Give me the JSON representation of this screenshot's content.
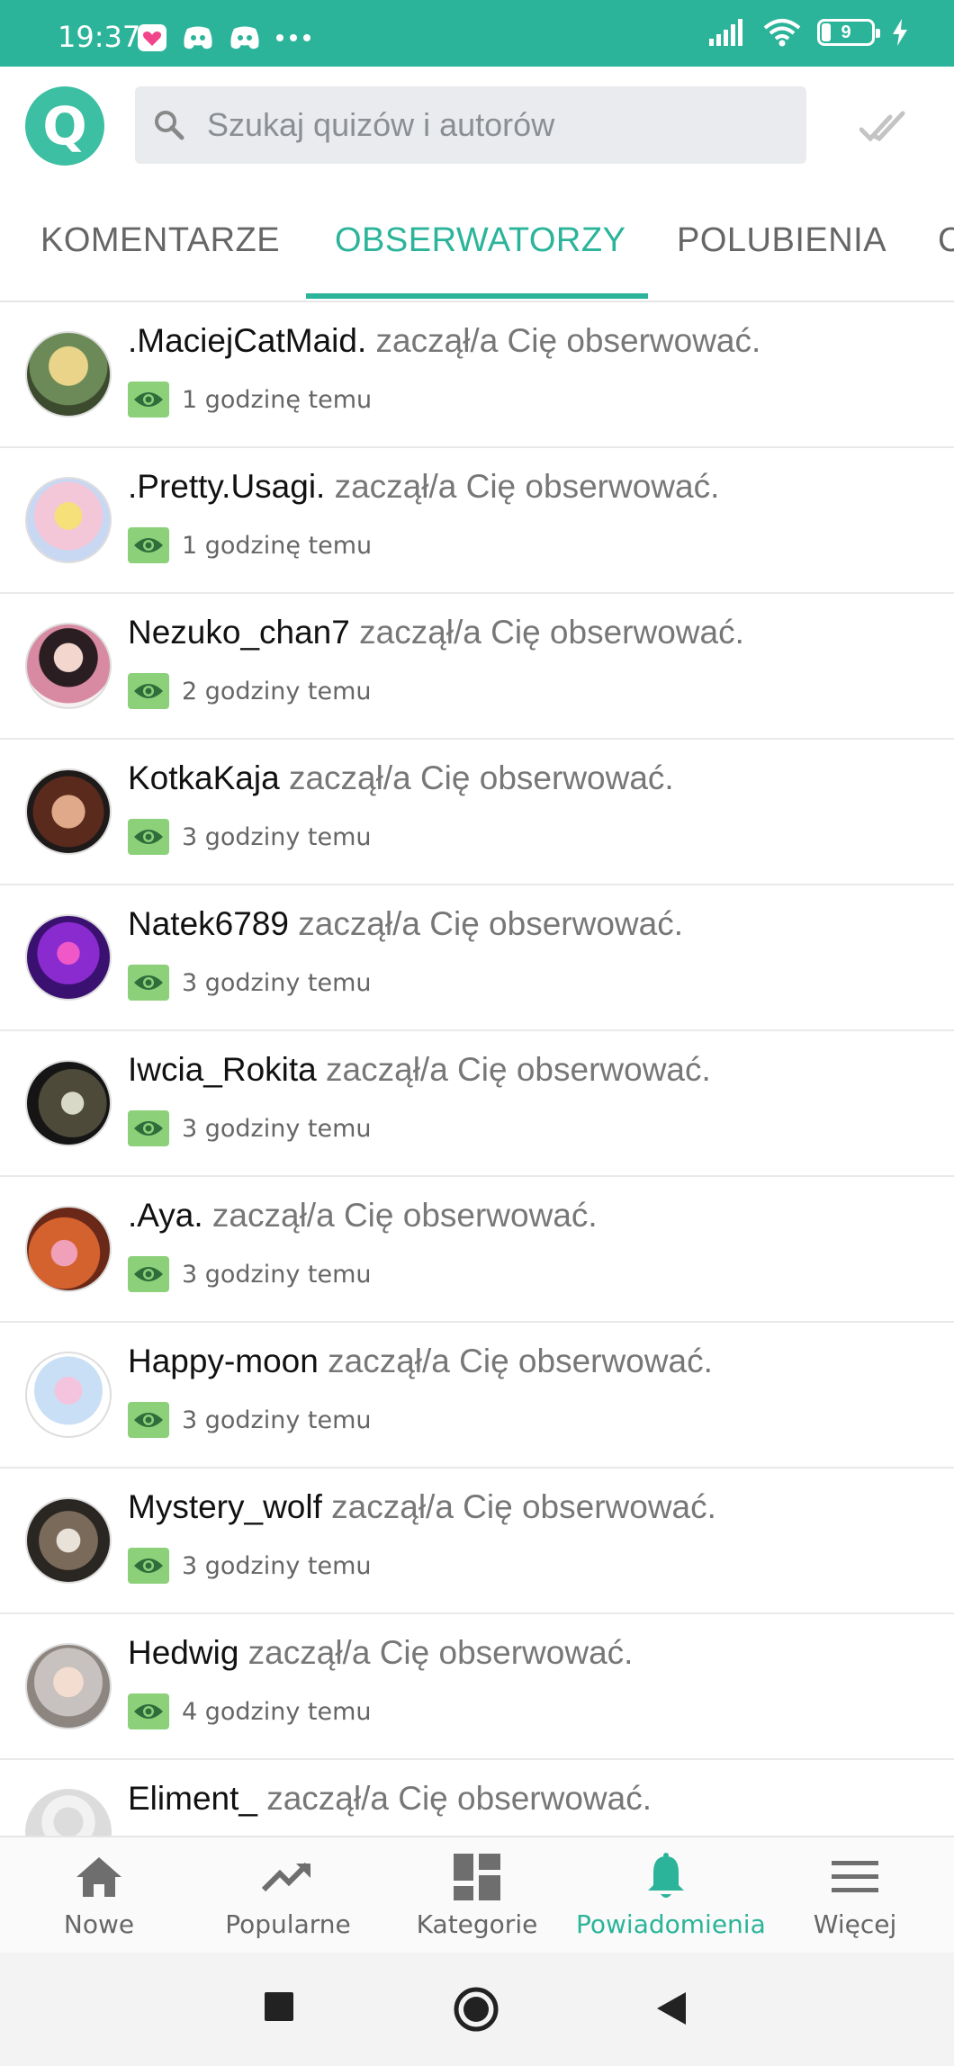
{
  "status_bar": {
    "time": "19:37",
    "battery": "9"
  },
  "app": {
    "logo_letter": "Q"
  },
  "search": {
    "placeholder": "Szukaj quizów i autorów"
  },
  "tabs": [
    {
      "label": "KOMENTARZE"
    },
    {
      "label": "OBSERWATORZY"
    },
    {
      "label": "POLUBIENIA"
    },
    {
      "label": "C"
    }
  ],
  "notifications": [
    {
      "name": ".MaciejCatMaid.",
      "action": " zaczął/a Cię obserwować.",
      "time": "1 godzinę temu"
    },
    {
      "name": ".Pretty.Usagi.",
      "action": " zaczął/a Cię obserwować.",
      "time": "1 godzinę temu"
    },
    {
      "name": "Nezuko_chan7",
      "action": " zaczął/a Cię obserwować.",
      "time": "2 godziny temu"
    },
    {
      "name": "KotkaKaja",
      "action": " zaczął/a Cię obserwować.",
      "time": "3 godziny temu"
    },
    {
      "name": "Natek6789",
      "action": " zaczął/a Cię obserwować.",
      "time": "3 godziny temu"
    },
    {
      "name": "Iwcia_Rokita",
      "action": " zaczął/a Cię obserwować.",
      "time": "3 godziny temu"
    },
    {
      "name": ".Aya.",
      "action": " zaczął/a Cię obserwować.",
      "time": "3 godziny temu"
    },
    {
      "name": "Happy-moon",
      "action": " zaczął/a Cię obserwować.",
      "time": "3 godziny temu"
    },
    {
      "name": "Mystery_wolf",
      "action": " zaczął/a Cię obserwować.",
      "time": "3 godziny temu"
    },
    {
      "name": "Hedwig",
      "action": " zaczął/a Cię obserwować.",
      "time": "4 godziny temu"
    },
    {
      "name": "Eliment_",
      "action": " zaczął/a Cię obserwować.",
      "time": ""
    }
  ],
  "bottom_nav": [
    {
      "label": "Nowe",
      "icon": "home-icon"
    },
    {
      "label": "Popularne",
      "icon": "trending-icon"
    },
    {
      "label": "Kategorie",
      "icon": "dashboard-icon"
    },
    {
      "label": "Powiadomienia",
      "icon": "bell-icon"
    },
    {
      "label": "Więcej",
      "icon": "menu-icon"
    }
  ],
  "colors": {
    "accent": "#2bb49a",
    "badge": "#8cd17a"
  }
}
